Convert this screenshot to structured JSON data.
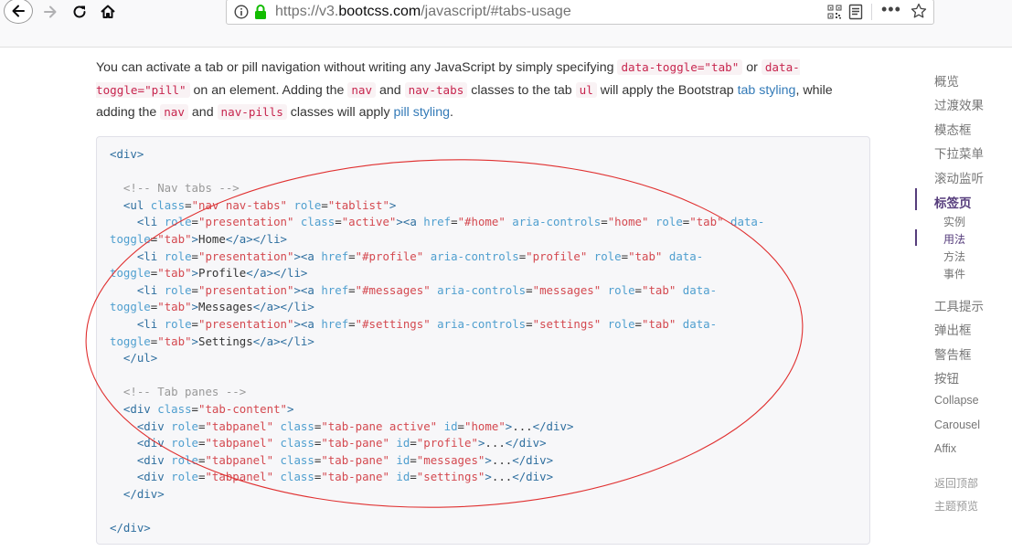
{
  "browser": {
    "url_scheme": "https://v3.",
    "url_domain": "bootcss.com",
    "url_path": "/javascript/#tabs-usage",
    "icons": [
      "back-icon",
      "forward-icon",
      "reload-icon",
      "home-icon",
      "info-icon",
      "lock-icon",
      "qr-code-icon",
      "reader-view-icon",
      "more-icon",
      "bookmark-star-icon"
    ]
  },
  "intro": {
    "t1": "You can activate a tab or pill navigation without writing any JavaScript by simply specifying ",
    "c1": "data-toggle=\"tab\"",
    "t2": " or ",
    "c2": "data-toggle=\"pill\"",
    "t3": " on an element. Adding the ",
    "c3": "nav",
    "t4": " and ",
    "c4": "nav-tabs",
    "t5": " classes to the tab ",
    "c5": "ul",
    "t6": " will apply the Bootstrap ",
    "l1": "tab styling",
    "t7": ", while adding the ",
    "c6": "nav",
    "t8": " and ",
    "c7": "nav-pills",
    "t9": " classes will apply ",
    "l2": "pill styling",
    "t10": "."
  },
  "code": {
    "div_open": "<div>",
    "cm_nav": "<!-- Nav tabs -->",
    "ul_lt": "<ul",
    "attr_class": "class",
    "attr_role": "role",
    "attr_href": "href",
    "attr_aria": "aria-controls",
    "attr_toggle_a": "data-",
    "attr_toggle_b": "toggle",
    "attr_id": "id",
    "v_navtabs": "\"nav nav-tabs\"",
    "v_tablist": "\"tablist\"",
    "li_lt": "<li",
    "a_lt": "<a",
    "gt": ">",
    "v_presentation": "\"presentation\"",
    "v_active": "\"active\"",
    "v_tab": "\"tab\"",
    "v_href_home": "\"#home\"",
    "v_home": "\"home\"",
    "v_href_profile": "\"#profile\"",
    "v_profile": "\"profile\"",
    "v_href_messages": "\"#messages\"",
    "v_messages": "\"messages\"",
    "v_href_settings": "\"#settings\"",
    "v_settings": "\"settings\"",
    "txt_home": "Home",
    "txt_profile": "Profile",
    "txt_messages": "Messages",
    "txt_settings": "Settings",
    "a_li_close": "</a></li>",
    "ul_close": "</ul>",
    "cm_panes": "<!-- Tab panes -->",
    "div_lt": "<div",
    "v_tabcontent": "\"tab-content\"",
    "v_tabpanel": "\"tabpanel\"",
    "v_pane_active": "\"tab-pane active\"",
    "v_pane": "\"tab-pane\"",
    "ellipsis": "...",
    "div_close": "</div>"
  },
  "sidebar": {
    "items": [
      "概览",
      "过渡效果",
      "模态框",
      "下拉菜单",
      "滚动监听",
      "标签页",
      "工具提示",
      "弹出框",
      "警告框",
      "按钮",
      "Collapse",
      "Carousel",
      "Affix"
    ],
    "subitems": [
      "实例",
      "用法",
      "方法",
      "事件"
    ],
    "back_to_top": "返回顶部",
    "theme_preview": "主题预览",
    "accent": "#563d7c"
  },
  "annotation": {
    "color": "#e03030"
  }
}
